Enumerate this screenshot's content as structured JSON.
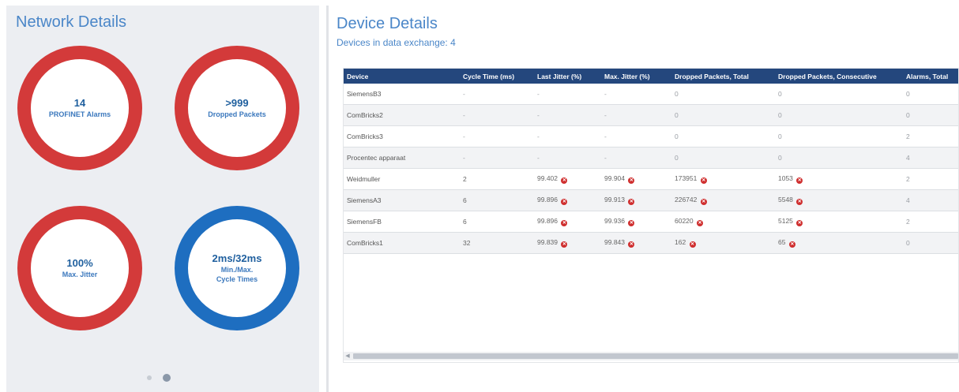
{
  "network": {
    "title": "Network Details",
    "gauges": [
      {
        "value": "14",
        "label": "PROFINET Alarms",
        "color": "#d33a3a"
      },
      {
        "value": ">999",
        "label": "Dropped Packets",
        "color": "#d33a3a"
      },
      {
        "value": "100%",
        "label": "Max. Jitter",
        "color": "#d33a3a"
      },
      {
        "value": "2ms/32ms",
        "label_line1": "Min./Max.",
        "label_line2": "Cycle Times",
        "color": "#1e6ec0"
      }
    ],
    "pager": {
      "page_count": 2,
      "active_page": 2
    }
  },
  "devices": {
    "title": "Device Details",
    "subtitle": "Devices in data exchange: 4",
    "columns": [
      "Device",
      "Cycle Time (ms)",
      "Last Jitter (%)",
      "Max. Jitter (%)",
      "Dropped Packets, Total",
      "Dropped Packets, Consecutive",
      "Alarms, Total"
    ],
    "rows": [
      [
        "SiemensB3",
        "-",
        "-",
        "-",
        "0",
        "0",
        "0"
      ],
      [
        "ComBricks2",
        "-",
        "-",
        "-",
        "0",
        "0",
        "0"
      ],
      [
        "ComBricks3",
        "-",
        "-",
        "-",
        "0",
        "0",
        "2"
      ],
      [
        "Procentec apparaat",
        "-",
        "-",
        "-",
        "0",
        "0",
        "4"
      ],
      [
        "Weidmuller",
        "2",
        "99.402",
        "99.904",
        "173951",
        "1053",
        "2"
      ],
      [
        "SiemensA3",
        "6",
        "99.896",
        "99.913",
        "226742",
        "5548",
        "4"
      ],
      [
        "SiemensFB",
        "6",
        "99.896",
        "99.936",
        "60220",
        "5125",
        "2"
      ],
      [
        "ComBricks1",
        "32",
        "99.839",
        "99.843",
        "162",
        "65",
        "0"
      ]
    ],
    "error_icon": "error-x-icon",
    "error_color": "#cf2e2e",
    "header_color": "#24477d"
  }
}
